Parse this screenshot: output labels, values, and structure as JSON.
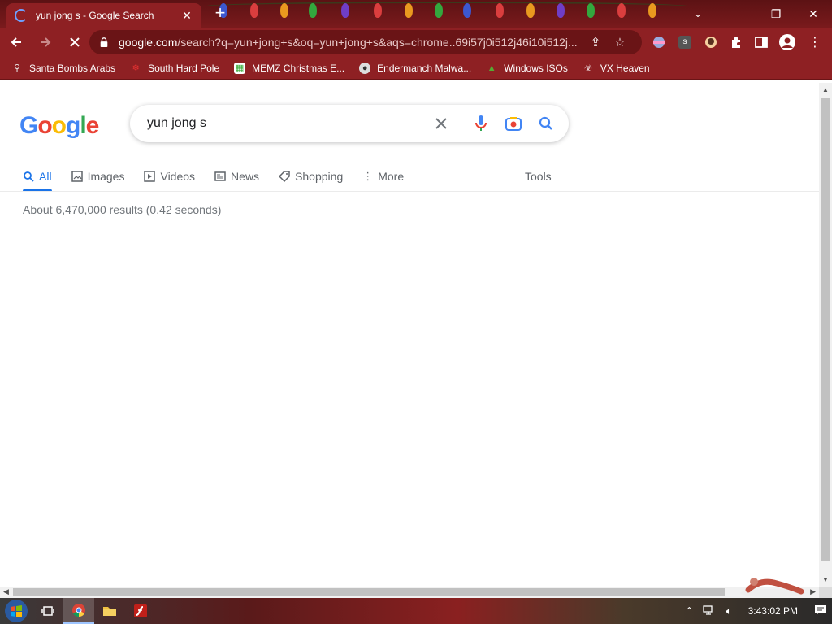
{
  "window": {
    "tab_title": "yun jong s - Google Search",
    "tab_close": "✕",
    "new_tab": "+",
    "minimize": "—",
    "restore": "❐",
    "close": "✕",
    "tab_search": "⌄"
  },
  "toolbar": {
    "url_host": "google.com",
    "url_rest": "/search?q=yun+jong+s&oq=yun+jong+s&aqs=chrome..69i57j0i512j46i10i512j..."
  },
  "bookmarks": [
    {
      "label": "Santa Bombs Arabs",
      "icon": "figure-icon",
      "color": "#e8e8e8"
    },
    {
      "label": "South Hard Pole",
      "icon": "snowflake-icon",
      "color": "#d33"
    },
    {
      "label": "MEMZ Christmas E...",
      "icon": "image-icon",
      "color": "#fff"
    },
    {
      "label": "Endermanch Malwa...",
      "icon": "raccoon-icon",
      "color": "#ccc"
    },
    {
      "label": "Windows ISOs",
      "icon": "tree-icon",
      "color": "#4a8a2a"
    },
    {
      "label": "VX Heaven",
      "icon": "biohazard-icon",
      "color": "#fff"
    }
  ],
  "search": {
    "query": "yun jong s",
    "logo": [
      "G",
      "o",
      "o",
      "g",
      "l",
      "e"
    ]
  },
  "nav_tabs": [
    {
      "label": "All",
      "icon": "search-icon",
      "active": true
    },
    {
      "label": "Images",
      "icon": "image-icon"
    },
    {
      "label": "Videos",
      "icon": "play-icon"
    },
    {
      "label": "News",
      "icon": "newspaper-icon"
    },
    {
      "label": "Shopping",
      "icon": "tag-icon"
    },
    {
      "label": "More",
      "icon": "more-vert-icon"
    }
  ],
  "tools_label": "Tools",
  "result_stats": "About 6,470,000 results (0.42 seconds)",
  "taskbar": {
    "clock": "3:43:02 PM"
  }
}
